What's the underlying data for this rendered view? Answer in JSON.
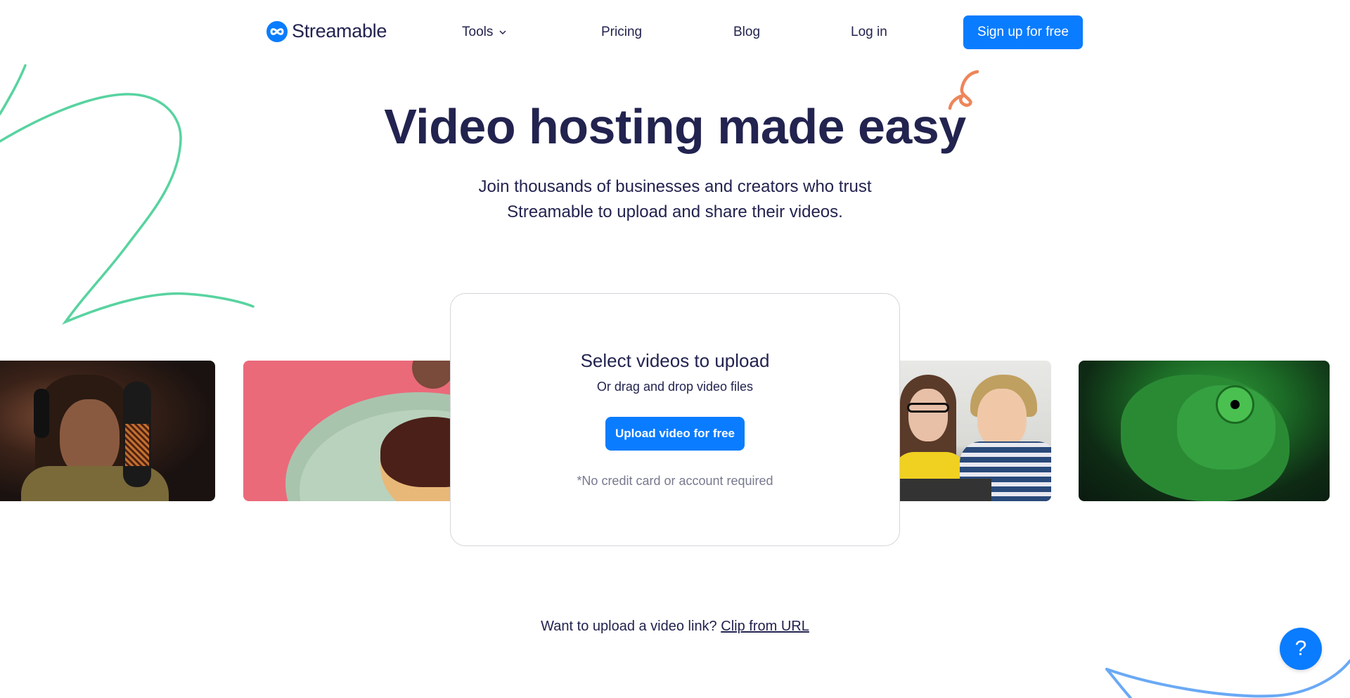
{
  "brand": {
    "name": "Streamable",
    "logo_icon": "infinity-loop-icon",
    "accent": "#0a7cff",
    "text": "#22234f",
    "muted": "#77798f"
  },
  "nav": {
    "tools_label": "Tools",
    "tools_icon": "chevron-down-icon",
    "pricing_label": "Pricing",
    "blog_label": "Blog",
    "login_label": "Log in",
    "signup_label": "Sign up for free"
  },
  "hero": {
    "title": "Video hosting made easy",
    "subtitle_line1": "Join thousands of businesses and creators who trust",
    "subtitle_line2": "Streamable to upload and share their videos."
  },
  "thumbnails": [
    {
      "subject": "man with headphones at studio microphone"
    },
    {
      "subject": "chocolate donut with sprinkles on plate"
    },
    {
      "subject": "two people looking at laptop"
    },
    {
      "subject": "green chameleon close-up"
    }
  ],
  "upload_card": {
    "title": "Select videos to upload",
    "subtitle": "Or drag and drop video files",
    "button_label": "Upload video for free",
    "note": "*No credit card or account required"
  },
  "clip": {
    "prompt": "Want to upload a video link?",
    "link_label": "Clip from URL"
  },
  "help": {
    "icon": "question-mark-icon",
    "label": "?"
  },
  "decorations": {
    "green_squiggle": "#58d3a0",
    "orange_curl": "#ee855a",
    "blue_swoosh": "#6aa9f5"
  }
}
